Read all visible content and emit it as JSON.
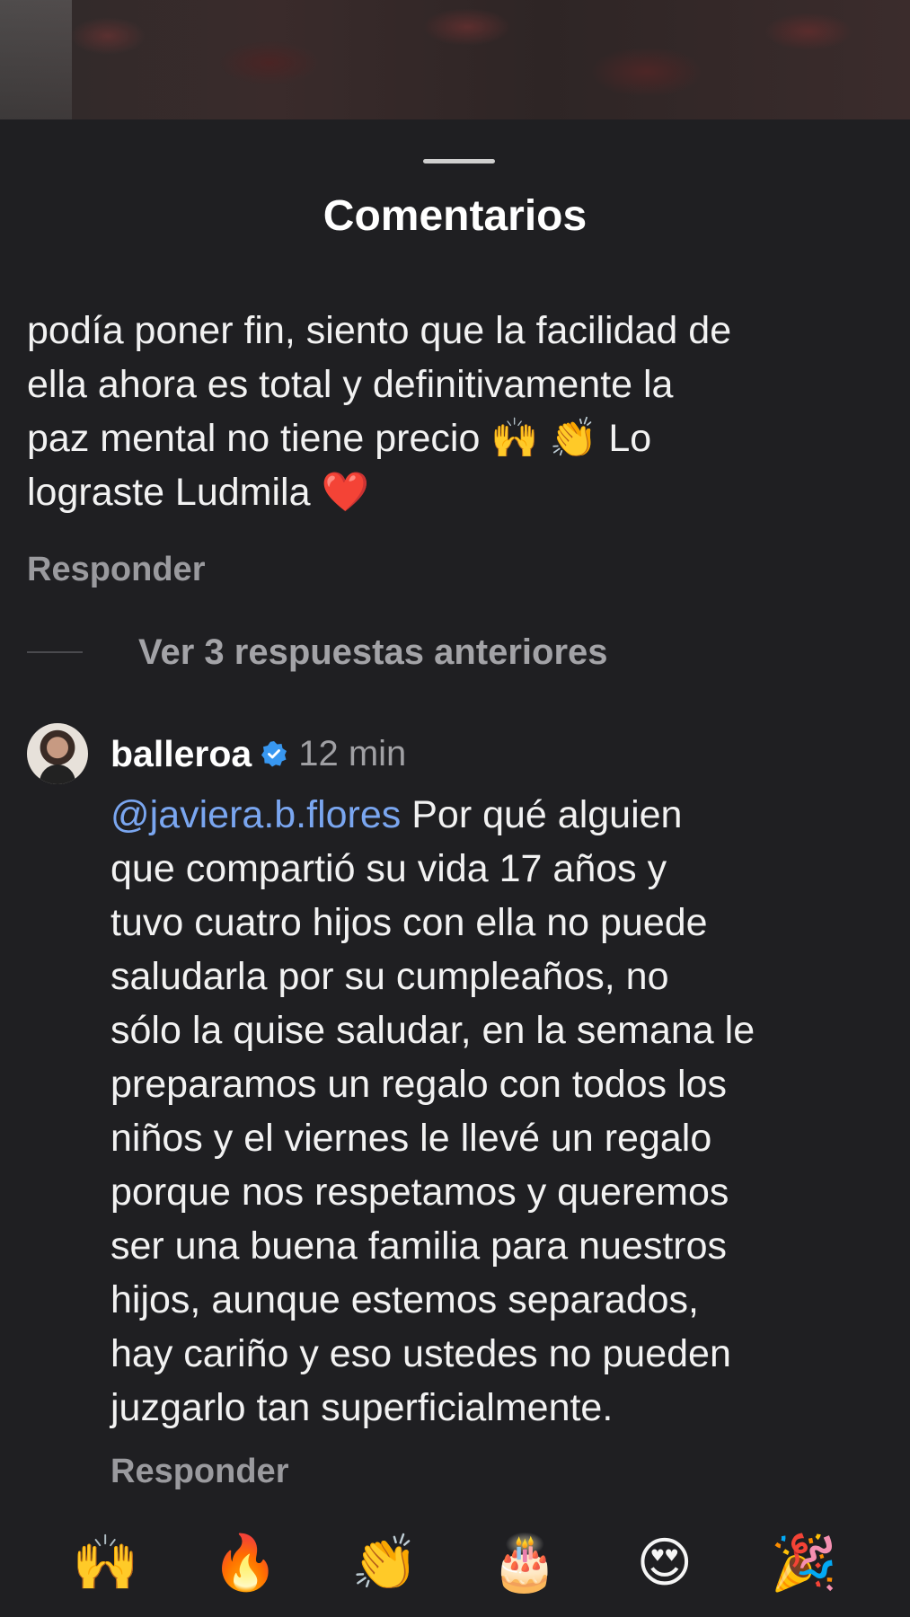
{
  "sheet": {
    "title": "Comentarios"
  },
  "previous_comment": {
    "text_line1": "podía poner fin, siento que la facilidad de",
    "text_line2": "ella ahora es total y definitivamente la",
    "text_line3_before": "paz mental no tiene precio",
    "emoji_raised_hands": "🙌",
    "emoji_clap": "👏",
    "text_line3_after": "Lo",
    "text_line4": "lograste Ludmila",
    "emoji_heart": "❤️",
    "reply_label": "Responder"
  },
  "view_replies": {
    "label": "Ver 3 respuestas anteriores"
  },
  "reply": {
    "username": "balleroa",
    "verified_icon": "verified-badge-icon",
    "time": "12 min",
    "mention": "@javiera.b.flores",
    "lines": [
      "Por qué alguien",
      "que compartió su vida 17 años y",
      "tuvo cuatro hijos con ella no puede",
      "saludarla por su cumpleaños, no",
      "sólo la quise saludar, en la semana le",
      "preparamos un regalo con todos los",
      "niños y el viernes le llevé un regalo",
      "porque nos respetamos y queremos",
      "ser una buena familia para nuestros",
      "hijos, aunque estemos separados,",
      "hay cariño y eso ustedes no pueden",
      "juzgarlo tan superficialmente."
    ],
    "reply_label": "Responder"
  },
  "reactions": [
    "🙌",
    "🔥",
    "👏",
    "🎂",
    "😍",
    "🎉"
  ],
  "colors": {
    "background": "#1f1f22",
    "mention": "#7aa6f0",
    "verified": "#3897f0",
    "secondary_text": "#a0a0a4"
  }
}
